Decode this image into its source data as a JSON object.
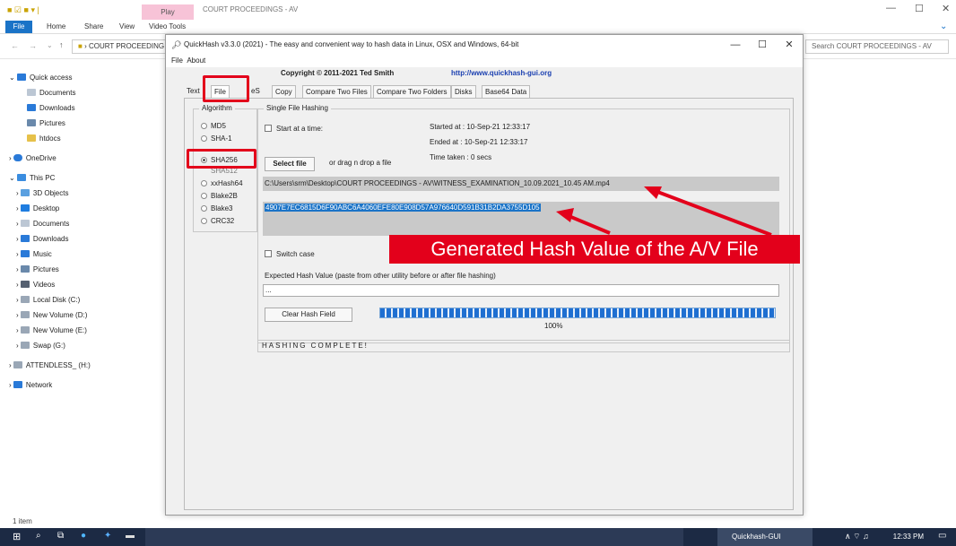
{
  "explorer": {
    "title": "COURT PROCEEDINGS - AV",
    "ribbon": {
      "file": "File",
      "home": "Home",
      "share": "Share",
      "view": "View",
      "play": "Play",
      "video_tools": "Video Tools"
    },
    "address": "COURT PROCEEDING",
    "search_placeholder": "Search COURT PROCEEDINGS - AV",
    "nav": [
      "Quick access",
      "Documents",
      "Downloads",
      "Pictures",
      "htdocs",
      "OneDrive",
      "This PC",
      "3D Objects",
      "Desktop",
      "Documents",
      "Downloads",
      "Music",
      "Pictures",
      "Videos",
      "Local Disk (C:)",
      "New Volume (D:)",
      "New Volume (E:)",
      "Swap (G:)",
      "ATTENDLESS_ (H:)",
      "Network"
    ],
    "status": "1 item"
  },
  "taskbar": {
    "app_label": "Quickhash-GUI",
    "time": "12:33 PM"
  },
  "quickhash": {
    "title": "QuickHash v3.3.0 (2021) - The easy and convenient way to hash data in Linux, OSX and Windows, 64-bit",
    "menu": {
      "file": "File",
      "about": "About"
    },
    "copyright": "Copyright © 2011-2021 Ted Smith",
    "url": "http://www.quickhash-gui.org",
    "tabs": [
      "Text",
      "File",
      "eS",
      "Copy",
      "Compare Two Files",
      "Compare Two Folders",
      "Disks",
      "Base64 Data"
    ],
    "algorithm_title": "Algorithm",
    "algorithms": [
      "MD5",
      "SHA-1",
      "SHA256",
      "SHA512",
      "xxHash64",
      "Blake2B",
      "Blake3",
      "CRC32"
    ],
    "single_title": "Single File Hashing",
    "start_at_time": "Start at a time:",
    "started_at": "Started at : 10-Sep-21 12:33:17",
    "ended_at": "Ended at   : 10-Sep-21 12:33:17",
    "time_taken": "Time taken : 0 secs",
    "select_file": "Select file",
    "drag_drop": "or drag n drop a file",
    "file_path": "C:\\Users\\srm\\Desktop\\COURT PROCEEDINGS - AV\\WITNESS_EXAMINATION_10.09.2021_10.45 AM.mp4",
    "hash_value": "4907E7EC6815D6F90ABC6A4060EFE80E908D57A976640D591B31B2DA3755D105",
    "switch_case": "Switch case",
    "expected_label": "Expected Hash Value (paste from other utility before or after file hashing)",
    "expected_value": "...",
    "clear_hash": "Clear Hash Field",
    "progress_percent": "100%",
    "status": "HASHING COMPLETE!"
  },
  "annotation": "Generated Hash Value of the A/V File",
  "colors": {
    "accent": "#1a73c7",
    "highlight": "#e3001b"
  }
}
